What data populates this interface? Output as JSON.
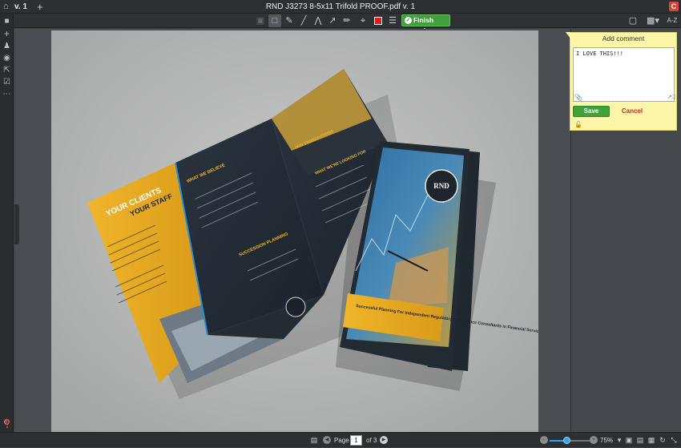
{
  "topbar": {
    "version_tab": "v. 1",
    "title": "RND J3273 8-5x11 Trifold PROOF.pdf v. 1",
    "badge": "C"
  },
  "toolbar": {
    "finish_label": "Finish review",
    "selected_color": "#e21b1b",
    "icons": [
      "crop-disabled-icon",
      "rectangle-icon",
      "pen-icon",
      "line-icon",
      "polyline-icon",
      "arrow-icon",
      "highlighter-icon",
      "crop-icon",
      "color-swatch",
      "menu-icon"
    ],
    "right": {
      "az_label": "A-Z"
    }
  },
  "sidebar": {
    "icons": [
      "folder-icon",
      "add-icon",
      "people-icon",
      "info-icon",
      "share-icon",
      "review-icon",
      "more-icon"
    ],
    "bottom_icons": [
      "settings-icon",
      "help-icon"
    ]
  },
  "document": {
    "brochure_text": {
      "left_panel_heading_1": "YOUR CLIENTS",
      "left_panel_heading_2": "YOUR STAFF",
      "what_we_believe": "WHAT WE BELIEVE",
      "succession_planning": "SUCCESSION PLANNING",
      "our_transactions": "OUR TRANSACTIONS",
      "what_were_looking_for": "WHAT WE'RE LOOKING FOR",
      "cover_logo": "RND",
      "cover_tagline": "Successful Planning For Independent Regulatory Compliance Consultants in Financial Services"
    }
  },
  "comment": {
    "title": "Add comment",
    "value": "I LOVE THIS!!!",
    "save_label": "Save",
    "cancel_label": "Cancel"
  },
  "pager": {
    "label": "Page",
    "current": "1",
    "of_label": "of 3"
  },
  "zoom": {
    "level_label": "75%",
    "fraction": 0.4
  }
}
